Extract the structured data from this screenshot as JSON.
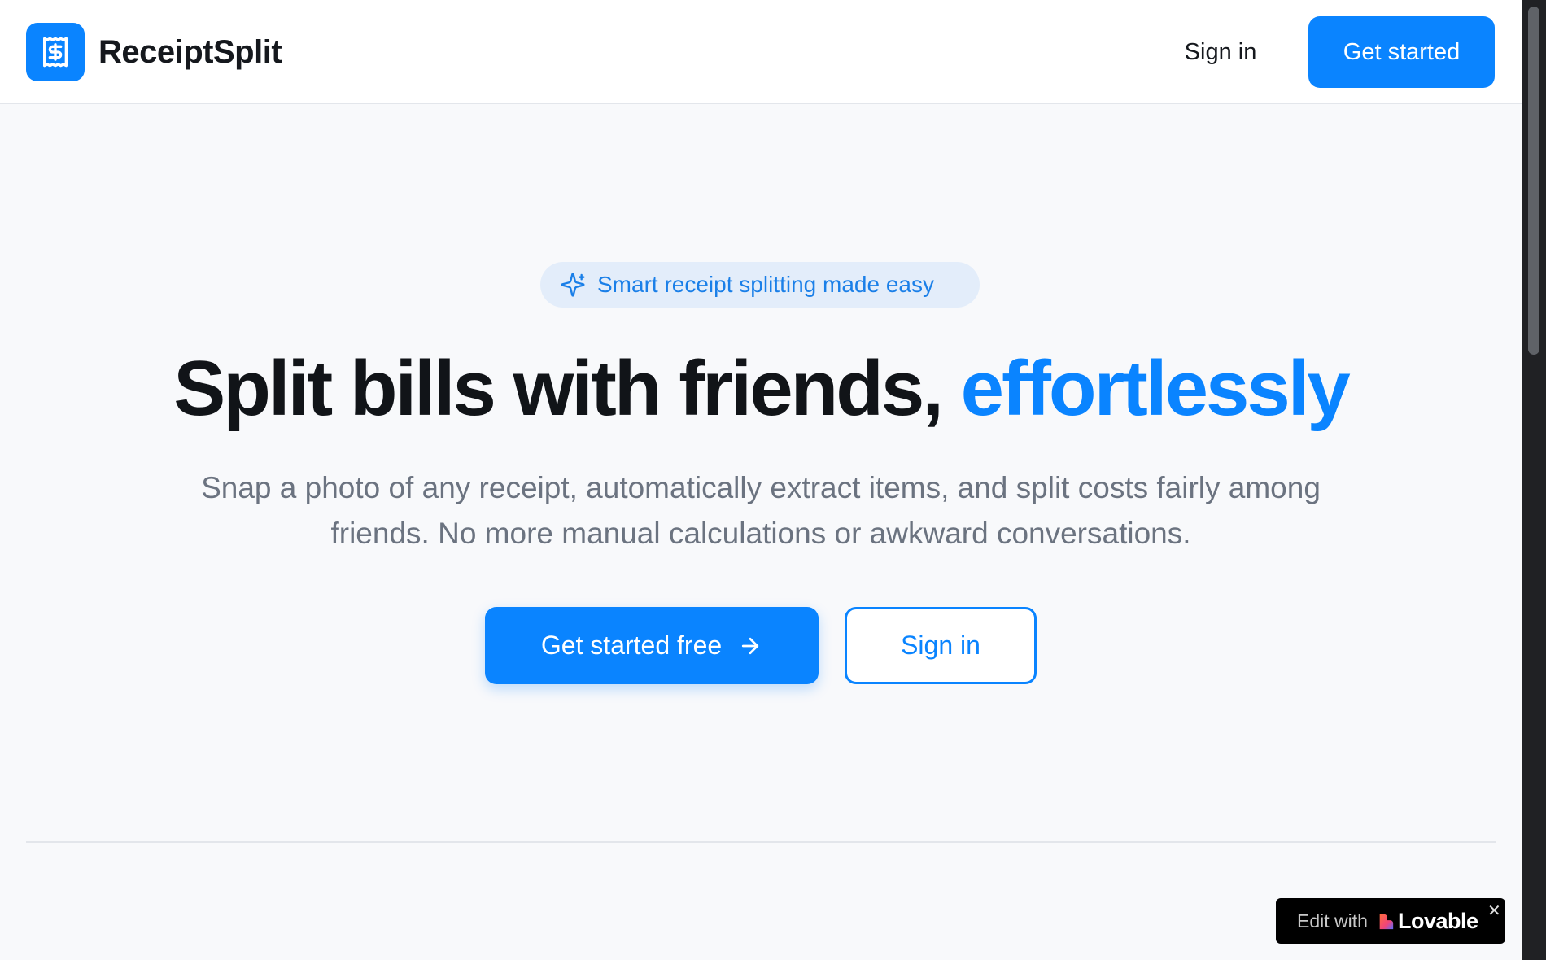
{
  "header": {
    "brand": "ReceiptSplit",
    "logo_icon": "receipt-dollar-icon",
    "sign_in_label": "Sign in",
    "get_started_label": "Get started"
  },
  "hero": {
    "badge_icon": "sparkles-icon",
    "badge_text": "Smart receipt splitting made easy",
    "headline_main": "Split bills with friends, ",
    "headline_accent": "effortlessly",
    "subtext": "Snap a photo of any receipt, automatically extract items, and split costs fairly among friends. No more manual calculations or awkward conversations.",
    "primary_cta_label": "Get started free",
    "primary_cta_icon": "arrow-right-icon",
    "secondary_cta_label": "Sign in"
  },
  "lovable_badge": {
    "edit_with": "Edit with",
    "name": "Lovable",
    "close_icon": "close-icon"
  },
  "colors": {
    "accent": "#0a84ff",
    "background": "#f8f9fb",
    "text_dark": "#111418",
    "text_muted": "#6b7380"
  }
}
